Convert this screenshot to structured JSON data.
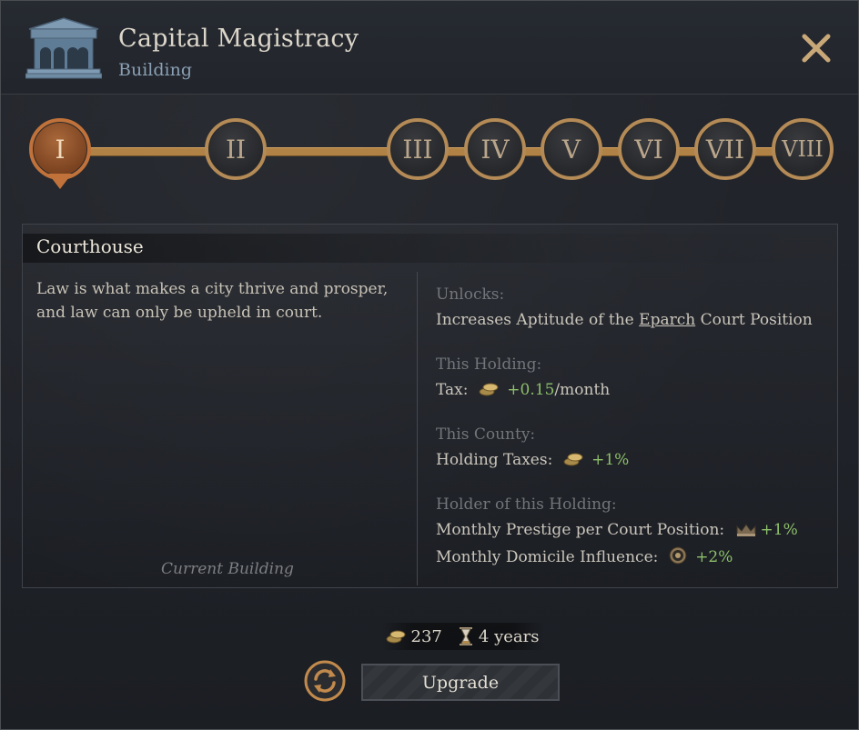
{
  "header": {
    "title": "Capital Magistracy",
    "subtitle": "Building",
    "building_icon": "building-icon",
    "close_icon": "close-icon"
  },
  "levels": {
    "items": [
      "I",
      "II",
      "III",
      "IV",
      "V",
      "VI",
      "VII",
      "VIII"
    ],
    "active_index": 0,
    "active_color": "#c1723b",
    "ring_color": "#b48a56"
  },
  "panel": {
    "title": "Courthouse",
    "description": "Law is what makes a city thrive and prosper, and law can only be upheld in court.",
    "status_label": "Current Building",
    "groups": [
      {
        "title": "Unlocks:",
        "lines": [
          {
            "pre": "Increases Aptitude of the ",
            "link": "Eparch",
            "post": " Court Position"
          }
        ]
      },
      {
        "title": "This Holding:",
        "lines": [
          {
            "label": "Tax:",
            "icon": "gold-coins-icon",
            "value": "+0.15",
            "suffix": "/month"
          }
        ]
      },
      {
        "title": "This County:",
        "lines": [
          {
            "label": "Holding Taxes:",
            "icon": "gold-coins-icon",
            "value": "+1%",
            "suffix": ""
          }
        ]
      },
      {
        "title": "Holder of this Holding:",
        "lines": [
          {
            "label": "Monthly Prestige per Court Position:",
            "icon": "crown-icon",
            "value": "+1%",
            "suffix": ""
          },
          {
            "label": "Monthly Domicile Influence:",
            "icon": "influence-icon",
            "value": "+2%",
            "suffix": ""
          }
        ]
      }
    ]
  },
  "cost": {
    "gold": "237",
    "time": "4 years",
    "gold_icon": "gold-coins-icon",
    "time_icon": "hourglass-icon"
  },
  "actions": {
    "upgrade_label": "Upgrade",
    "cycle_icon": "cycle-icon"
  },
  "colors": {
    "positive": "#8dbf6a",
    "title_text": "#dcd6ca",
    "subtitle_text": "#8aa0b4"
  }
}
